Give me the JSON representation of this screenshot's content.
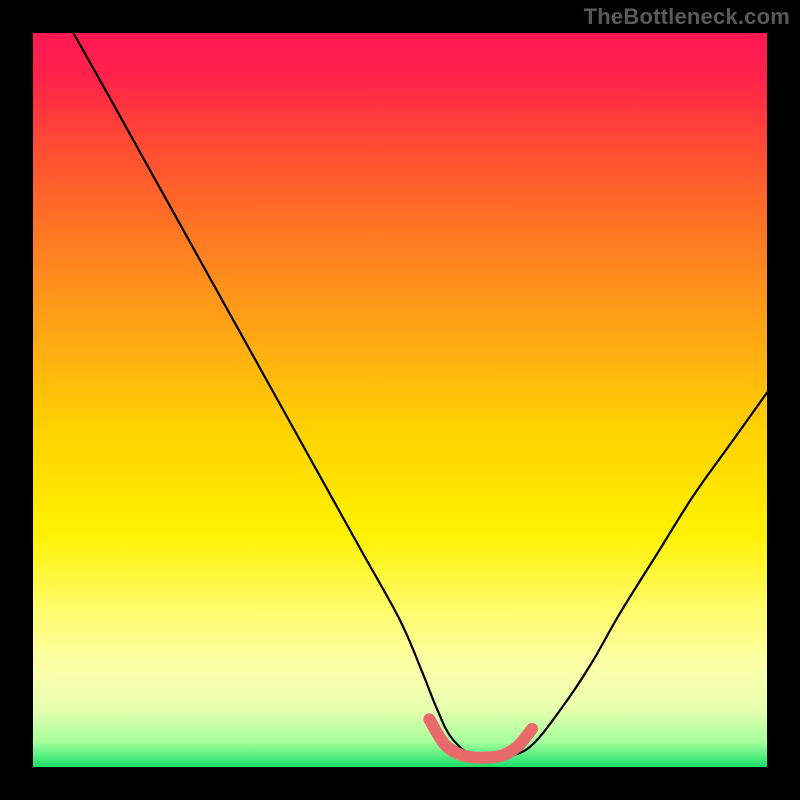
{
  "watermark": "TheBottleneck.com",
  "colors": {
    "frame": "#000000",
    "gradient_stops": [
      {
        "offset": 0.0,
        "color": "#ff1854"
      },
      {
        "offset": 0.06,
        "color": "#ff2249"
      },
      {
        "offset": 0.15,
        "color": "#ff4a34"
      },
      {
        "offset": 0.28,
        "color": "#ff7a22"
      },
      {
        "offset": 0.42,
        "color": "#ffaa14"
      },
      {
        "offset": 0.55,
        "color": "#ffd400"
      },
      {
        "offset": 0.68,
        "color": "#fff200"
      },
      {
        "offset": 0.78,
        "color": "#fffb66"
      },
      {
        "offset": 0.86,
        "color": "#fdffa8"
      },
      {
        "offset": 0.92,
        "color": "#e8ffb0"
      },
      {
        "offset": 0.965,
        "color": "#a8ff9c"
      },
      {
        "offset": 1.0,
        "color": "#18e06a"
      }
    ],
    "curve": "#000000",
    "highlight": "#e86a6a"
  },
  "chart_data": {
    "type": "line",
    "title": "",
    "xlabel": "",
    "ylabel": "",
    "xlim": [
      0,
      100
    ],
    "ylim": [
      0,
      100
    ],
    "grid": false,
    "series": [
      {
        "name": "bottleneck-curve",
        "x": [
          5.5,
          10,
          15,
          20,
          25,
          30,
          35,
          40,
          45,
          50,
          53,
          55,
          57,
          60,
          63,
          65,
          68,
          72,
          76,
          80,
          85,
          90,
          95,
          100
        ],
        "y": [
          100,
          92,
          83,
          74,
          65,
          56,
          47,
          38,
          29,
          20,
          13,
          8,
          4,
          1.5,
          1.2,
          1.5,
          3,
          8,
          14,
          21,
          29,
          37,
          44,
          51
        ]
      }
    ],
    "annotations": [
      {
        "name": "optimal-highlight",
        "type": "segment",
        "x": [
          54,
          56,
          58,
          60,
          62,
          64,
          66,
          68
        ],
        "y": [
          6.5,
          3.2,
          1.8,
          1.3,
          1.3,
          1.6,
          2.8,
          5.2
        ]
      }
    ]
  }
}
